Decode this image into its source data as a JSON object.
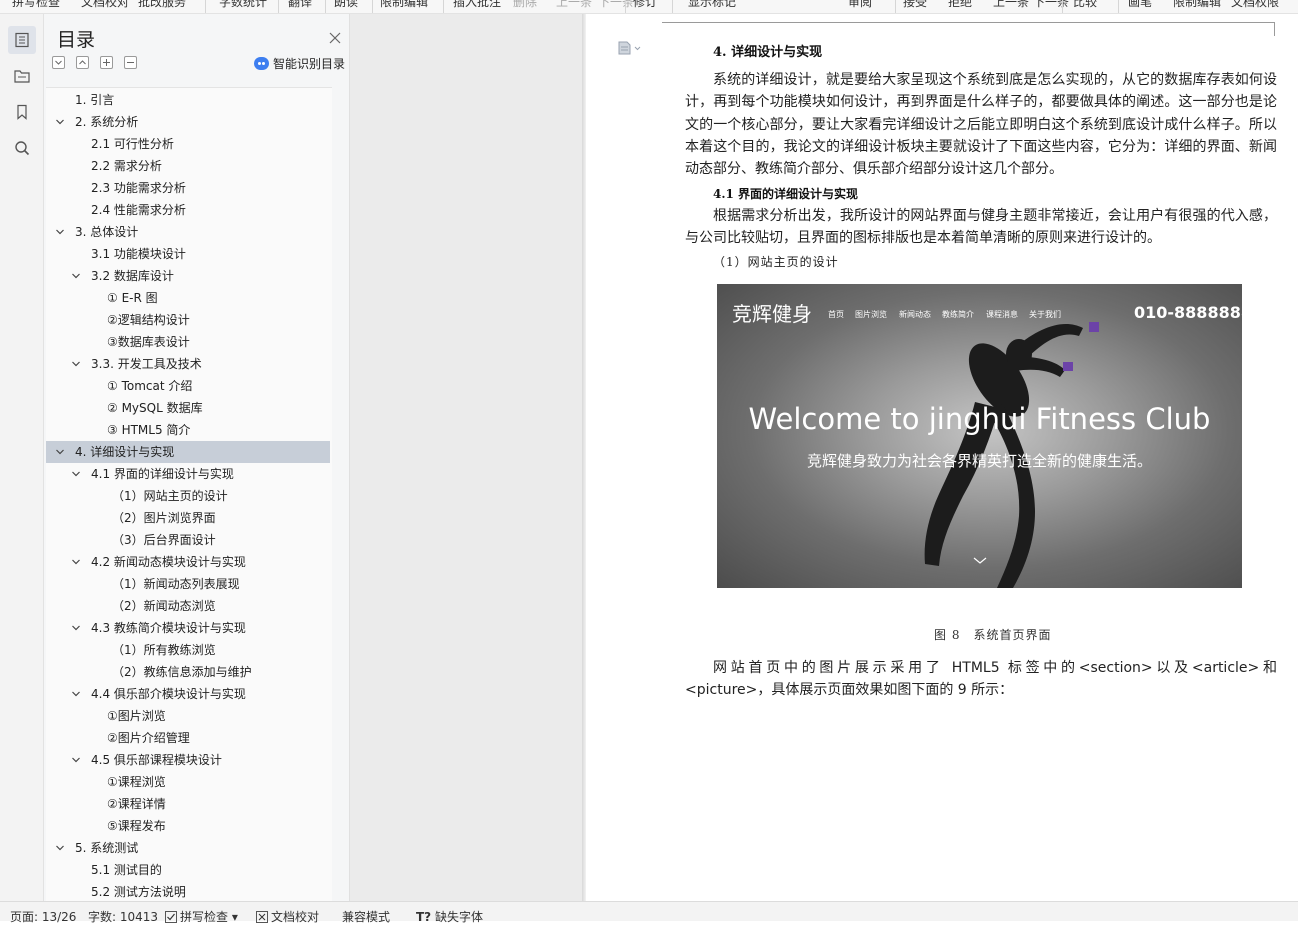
{
  "ribbon": {
    "items": [
      "拼写检查",
      "文档校对",
      "批改服务",
      "字数统计",
      "翻译",
      "朗读",
      "限制编辑",
      "插入批注",
      "删除",
      "上一条",
      "下一条",
      "修订",
      "显示标记",
      "审阅",
      "接受",
      "拒绝",
      "上一条",
      "下一条",
      "比较",
      "画笔",
      "限制编辑",
      "文档权限"
    ]
  },
  "rail": {
    "icons": [
      "outline-icon",
      "chapter-nav-icon",
      "bookmark-icon",
      "search-icon"
    ]
  },
  "toc": {
    "title": "目录",
    "smart_label": "智能识别目录",
    "items": [
      {
        "label": "1. 引言",
        "level": 1,
        "expand": false
      },
      {
        "label": "2. 系统分析",
        "level": 1,
        "expand": true
      },
      {
        "label": "2.1 可行性分析",
        "level": 2,
        "expand": false
      },
      {
        "label": "2.2 需求分析",
        "level": 2,
        "expand": false
      },
      {
        "label": "2.3 功能需求分析",
        "level": 2,
        "expand": false
      },
      {
        "label": "2.4 性能需求分析",
        "level": 2,
        "expand": false
      },
      {
        "label": "3. 总体设计",
        "level": 1,
        "expand": true
      },
      {
        "label": "3.1 功能模块设计",
        "level": 2,
        "expand": false
      },
      {
        "label": "3.2 数据库设计",
        "level": 2,
        "expand": true
      },
      {
        "label": "① E-R 图",
        "level": 3,
        "expand": false
      },
      {
        "label": "②逻辑结构设计",
        "level": 3,
        "expand": false
      },
      {
        "label": "③数据库表设计",
        "level": 3,
        "expand": false
      },
      {
        "label": "3.3. 开发工具及技术",
        "level": 2,
        "expand": true
      },
      {
        "label": "① Tomcat 介绍",
        "level": 3,
        "expand": false
      },
      {
        "label": "② MySQL 数据库",
        "level": 3,
        "expand": false
      },
      {
        "label": "③ HTML5 简介",
        "level": 3,
        "expand": false
      },
      {
        "label": "4. 详细设计与实现",
        "level": 1,
        "expand": true,
        "selected": true
      },
      {
        "label": "4.1 界面的详细设计与实现",
        "level": 2,
        "expand": true
      },
      {
        "label": "（1）网站主页的设计",
        "level": 4,
        "expand": false
      },
      {
        "label": "（2）图片浏览界面",
        "level": 4,
        "expand": false
      },
      {
        "label": "（3）后台界面设计",
        "level": 4,
        "expand": false
      },
      {
        "label": "4.2 新闻动态模块设计与实现",
        "level": 2,
        "expand": true
      },
      {
        "label": "（1）新闻动态列表展现",
        "level": 4,
        "expand": false
      },
      {
        "label": "（2）新闻动态浏览",
        "level": 4,
        "expand": false
      },
      {
        "label": "4.3 教练简介模块设计与实现",
        "level": 2,
        "expand": true
      },
      {
        "label": "（1）所有教练浏览",
        "level": 4,
        "expand": false
      },
      {
        "label": "（2）教练信息添加与维护",
        "level": 4,
        "expand": false
      },
      {
        "label": "4.4 俱乐部介模块设计与实现",
        "level": 2,
        "expand": true
      },
      {
        "label": "①图片浏览",
        "level": 3,
        "expand": false
      },
      {
        "label": "②图片介绍管理",
        "level": 3,
        "expand": false
      },
      {
        "label": "4.5 俱乐部课程模块设计",
        "level": 2,
        "expand": true
      },
      {
        "label": "①课程浏览",
        "level": 3,
        "expand": false
      },
      {
        "label": "②课程详情",
        "level": 3,
        "expand": false
      },
      {
        "label": "⑤课程发布",
        "level": 3,
        "expand": false
      },
      {
        "label": "5. 系统测试",
        "level": 1,
        "expand": true
      },
      {
        "label": "5.1 测试目的",
        "level": 2,
        "expand": false
      },
      {
        "label": "5.2 测试方法说明",
        "level": 2,
        "expand": false
      }
    ]
  },
  "doc": {
    "heading": "4. 详细设计与实现",
    "para1": "系统的详细设计，就是要给大家呈现这个系统到底是怎么实现的，从它的数据库存表如何设计，再到每个功能模块如何设计，再到界面是什么样子的，都要做具体的阐述。这一部分也是论文的一个核心部分，要让大家看完详细设计之后能立即明白这个系统到底设计成什么样子。所以本着这个目的，我论文的详细设计板块主要就设计了下面这些内容，它分为：详细的界面、新闻动态部分、教练简介部分、俱乐部介绍部分设计这几个部分。",
    "subheading": "4.1 界面的详细设计与实现",
    "para2": "根据需求分析出发，我所设计的网站界面与健身主题非常接近，会让用户有很强的代入感，与公司比较贴切，且界面的图标排版也是本着简单清晰的原则来进行设计的。",
    "item1": "（1）网站主页的设计",
    "hero": {
      "brand": "竞辉健身",
      "nav": [
        "首页",
        "图片浏览",
        "新闻动态",
        "教练简介",
        "课程消息",
        "关于我们"
      ],
      "phone": "010-8888888",
      "welcome": "Welcome to jinghui Fitness Club",
      "slogan": "竞辉健身致力为社会各界精英打造全新的健康生活。"
    },
    "caption": "图 8　系统首页界面",
    "para3": "网站首页中的图片展示采用了 HTML5 标签中的<section>以及<article>和<picture>，具体展示页面效果如图下面的 9 所示："
  },
  "status": {
    "page": "页面: 13/26",
    "words": "字数: 10413",
    "spell": "拼写检查",
    "proof": "文档校对",
    "compat": "兼容模式",
    "missing_font": "缺失字体"
  }
}
